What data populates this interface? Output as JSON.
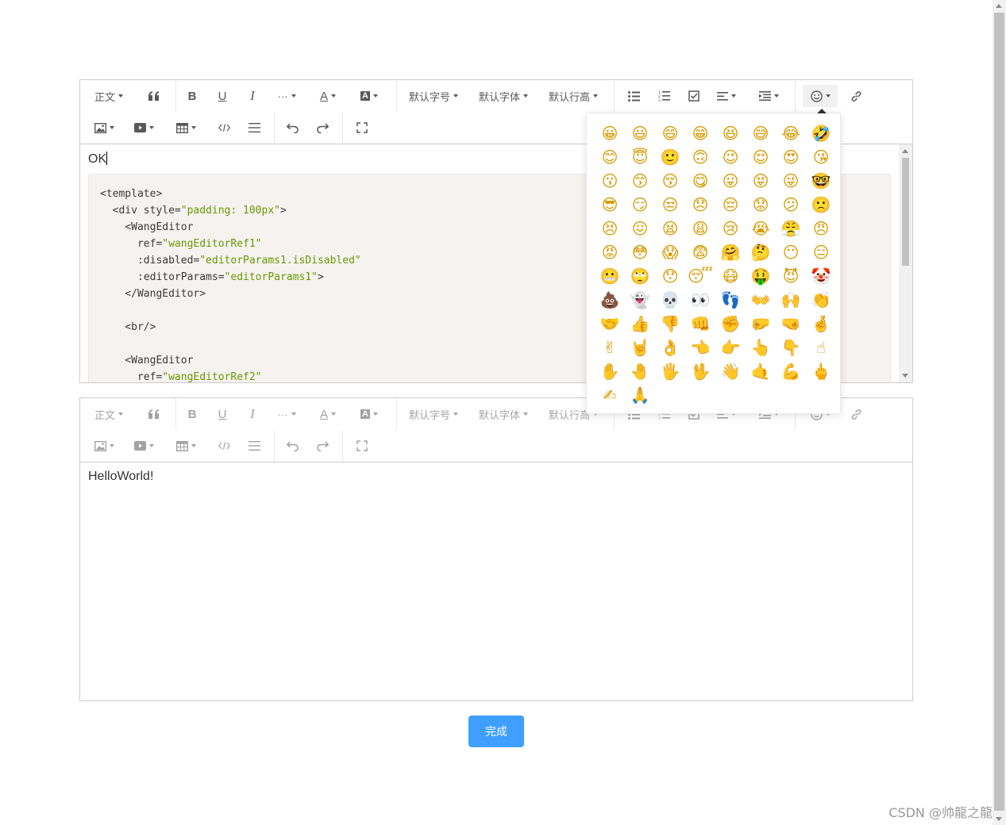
{
  "editor1": {
    "toolbar": {
      "heading_label": "正文",
      "font_size_label": "默认字号",
      "font_family_label": "默认字体",
      "line_height_label": "默认行高"
    },
    "first_paragraph": "OK",
    "code_lines": [
      [
        "<template>",
        ""
      ],
      [
        "  <div style=",
        "\"padding: 100px\"",
        ">"
      ],
      [
        "    <WangEditor",
        ""
      ],
      [
        "      ref=",
        "\"wangEditorRef1\"",
        ""
      ],
      [
        "      :disabled=",
        "\"editorParams1.isDisabled\"",
        ""
      ],
      [
        "      :editorParams=",
        "\"editorParams1\"",
        ">"
      ],
      [
        "    </WangEditor>",
        ""
      ],
      [
        "",
        ""
      ],
      [
        "    <br/>",
        ""
      ],
      [
        "",
        ""
      ],
      [
        "    <WangEditor",
        ""
      ],
      [
        "      ref=",
        "\"wangEditorRef2\"",
        ""
      ]
    ]
  },
  "editor2": {
    "toolbar": {
      "heading_label": "正文",
      "font_size_label": "默认字号",
      "font_family_label": "默认字体",
      "line_height_label": "默认行高"
    },
    "first_paragraph": "HelloWorld!"
  },
  "emoji_panel": {
    "emojis": [
      "😀",
      "😃",
      "😄",
      "😁",
      "😆",
      "😅",
      "😂",
      "🤣",
      "😊",
      "😇",
      "🙂",
      "🙃",
      "😉",
      "😌",
      "😍",
      "😘",
      "😗",
      "😙",
      "😚",
      "😋",
      "😛",
      "😝",
      "😜",
      "🤓",
      "😎",
      "😏",
      "😒",
      "😞",
      "😔",
      "😟",
      "😕",
      "🙁",
      "😣",
      "😖",
      "😫",
      "😩",
      "😢",
      "😭",
      "😤",
      "😠",
      "😡",
      "😳",
      "😱",
      "😨",
      "🤗",
      "🤔",
      "😶",
      "😑",
      "😬",
      "🙄",
      "😯",
      "😴",
      "😷",
      "🤑",
      "😈",
      "🤡",
      "💩",
      "👻",
      "💀",
      "👀",
      "👣",
      "👐",
      "🙌",
      "👏",
      "🤝",
      "👍",
      "👎",
      "👊",
      "✊",
      "🤛",
      "🤜",
      "🤞",
      "✌",
      "🤘",
      "👌",
      "👈",
      "👉",
      "👆",
      "👇",
      "☝",
      "✋",
      "🤚",
      "🖐",
      "🖖",
      "👋",
      "🤙",
      "💪",
      "🖕",
      "✍",
      "🙏"
    ]
  },
  "done_button_label": "完成",
  "watermark": "CSDN @帅龍之龍",
  "colors": {
    "primary_button": "#409eff",
    "code_background": "#f5f2f0",
    "code_string": "#669900"
  }
}
